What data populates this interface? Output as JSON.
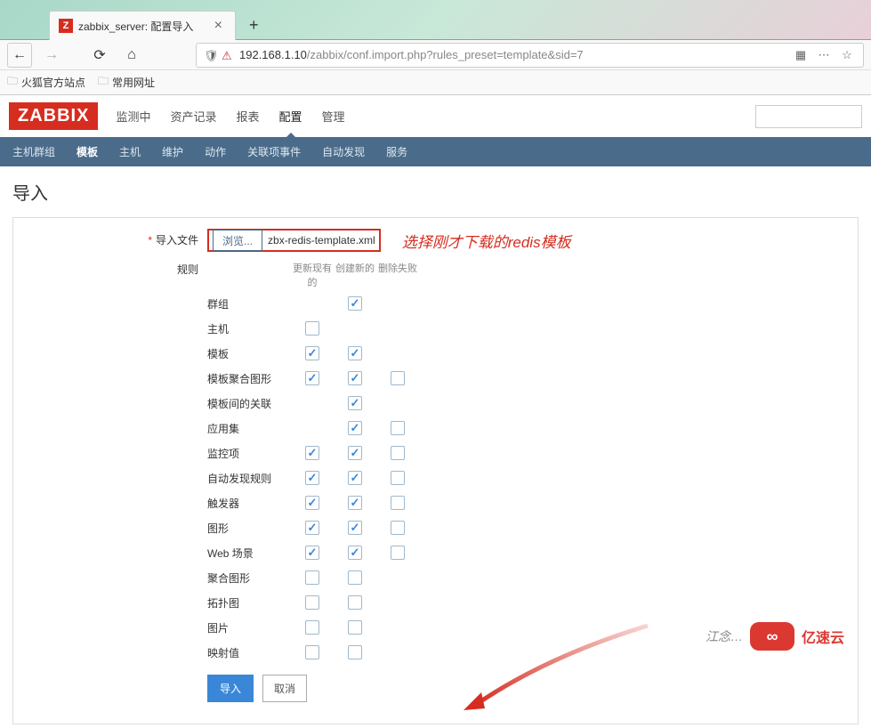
{
  "browser": {
    "tab_title": "zabbix_server: 配置导入",
    "tab_icon_letter": "Z",
    "url_host": "192.168.1.10",
    "url_path": "/zabbix/conf.import.php?rules_preset=template&sid=7",
    "bookmarks": [
      {
        "name": "火狐官方站点"
      },
      {
        "name": "常用网址"
      }
    ]
  },
  "zabbix": {
    "logo": "ZABBIX",
    "top_menu": [
      {
        "label": "监测中",
        "active": false
      },
      {
        "label": "资产记录",
        "active": false
      },
      {
        "label": "报表",
        "active": false
      },
      {
        "label": "配置",
        "active": true
      },
      {
        "label": "管理",
        "active": false
      }
    ],
    "sub_menu": [
      {
        "label": "主机群组",
        "active": false
      },
      {
        "label": "模板",
        "active": true
      },
      {
        "label": "主机",
        "active": false
      },
      {
        "label": "维护",
        "active": false
      },
      {
        "label": "动作",
        "active": false
      },
      {
        "label": "关联项事件",
        "active": false
      },
      {
        "label": "自动发现",
        "active": false
      },
      {
        "label": "服务",
        "active": false
      }
    ],
    "page_title": "导入",
    "form": {
      "import_file_label": "导入文件",
      "browse_label": "浏览...",
      "file_name": "zbx-redis-template.xml",
      "annotation": "选择刚才下载的redis模板",
      "rules_label": "规则",
      "col_update": "更新现有的",
      "col_create": "创建新的",
      "col_delete": "删除失败",
      "rules": [
        {
          "name": "群组",
          "c1": null,
          "c2": true,
          "c3": null
        },
        {
          "name": "主机",
          "c1": false,
          "c2": null,
          "c3": null
        },
        {
          "name": "模板",
          "c1": true,
          "c2": true,
          "c3": null
        },
        {
          "name": "模板聚合图形",
          "c1": true,
          "c2": true,
          "c3": false
        },
        {
          "name": "模板间的关联",
          "c1": null,
          "c2": true,
          "c3": null
        },
        {
          "name": "应用集",
          "c1": null,
          "c2": true,
          "c3": false
        },
        {
          "name": "监控项",
          "c1": true,
          "c2": true,
          "c3": false
        },
        {
          "name": "自动发现规则",
          "c1": true,
          "c2": true,
          "c3": false
        },
        {
          "name": "触发器",
          "c1": true,
          "c2": true,
          "c3": false
        },
        {
          "name": "图形",
          "c1": true,
          "c2": true,
          "c3": false
        },
        {
          "name": "Web 场景",
          "c1": true,
          "c2": true,
          "c3": false
        },
        {
          "name": "聚合图形",
          "c1": false,
          "c2": false,
          "c3": null
        },
        {
          "name": "拓扑图",
          "c1": false,
          "c2": false,
          "c3": null
        },
        {
          "name": "图片",
          "c1": false,
          "c2": false,
          "c3": null
        },
        {
          "name": "映射值",
          "c1": false,
          "c2": false,
          "c3": null
        }
      ],
      "btn_import": "导入",
      "btn_cancel": "取消"
    }
  },
  "watermark": {
    "text": "江念…",
    "brand": "亿速云"
  }
}
